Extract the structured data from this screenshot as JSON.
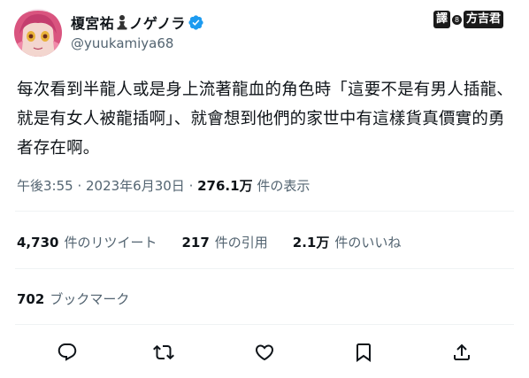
{
  "author": {
    "display_name": "榎宮祐",
    "name_suffix": "ノゲノラ",
    "handle": "@yuukamiya68",
    "avatar_icon": "anime-avatar-icon",
    "name_emoji_icon": "chess-pawn-icon",
    "verified_icon": "verified-badge-icon",
    "verified_color": "#1d9bf0"
  },
  "watermark": {
    "part1": "譯",
    "part2": "8",
    "part3": "方吉君"
  },
  "tweet": {
    "text": "每次看到半龍人或是身上流著龍血的角色時「這要不是有男人插龍、就是有女人被龍插啊」、就會想到他們的家世中有這樣貨真價實的勇者存在啊。"
  },
  "meta": {
    "time": "午後3:55",
    "separator": " · ",
    "date": "2023年6月30日",
    "separator2": " · ",
    "views": "276.1万",
    "views_label": " 件の表示"
  },
  "stats": {
    "retweets_count": "4,730",
    "retweets_label": "件のリツイート",
    "quotes_count": "217",
    "quotes_label": "件の引用",
    "likes_count": "2.1万",
    "likes_label": "件のいいね"
  },
  "bookmarks": {
    "count": "702",
    "label": "ブックマーク"
  },
  "actions": {
    "reply_icon": "reply-icon",
    "retweet_icon": "retweet-icon",
    "like_icon": "heart-icon",
    "bookmark_icon": "bookmark-icon",
    "share_icon": "share-icon"
  },
  "colors": {
    "text_primary": "#0f1419",
    "text_secondary": "#536471",
    "divider": "#eff3f4"
  }
}
